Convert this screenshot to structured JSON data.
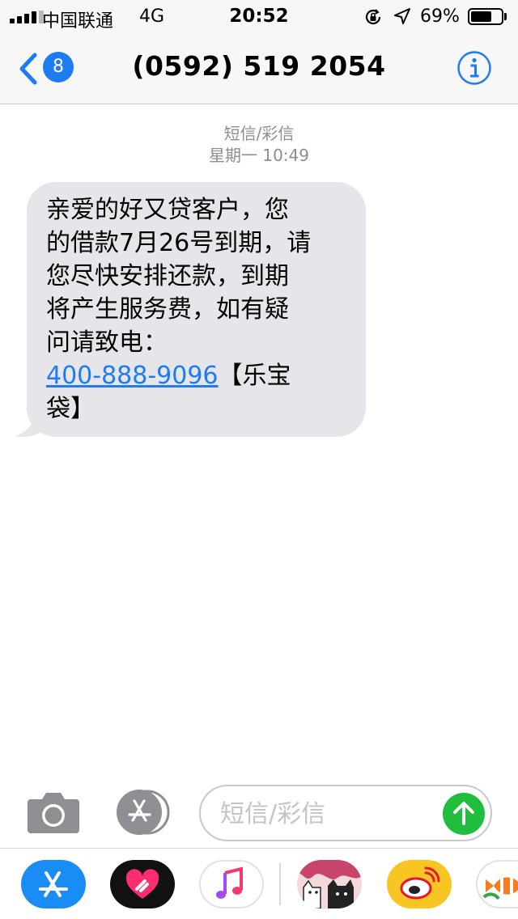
{
  "status_bar": {
    "carrier": "中国联通",
    "network": "4G",
    "time": "20:52",
    "battery": "69%",
    "battery_level": 0.69
  },
  "nav": {
    "back_badge": "8",
    "title": "(0592) 519 2054"
  },
  "conversation": {
    "service_label": "短信/彩信",
    "timestamp": "星期一 10:49"
  },
  "message": {
    "lines": [
      "亲爱的好又贷客户，您",
      "的借款7月26号到期，请",
      "您尽快安排还款，到期",
      "将产生服务费，如有疑",
      "问请致电："
    ],
    "phone_link": "400-888-9096",
    "suffix": "【乐宝",
    "last_line": "袋】"
  },
  "composer": {
    "placeholder": "短信/彩信"
  },
  "colors": {
    "accent": "#1e7cf2",
    "send": "#1fbf3d",
    "bubble": "#e5e5ea"
  },
  "drawer_icons": [
    "app-store-icon",
    "digital-touch-icon",
    "music-icon",
    "sticker-cats-icon",
    "weibo-icon",
    "clownfish-sticker-icon"
  ]
}
